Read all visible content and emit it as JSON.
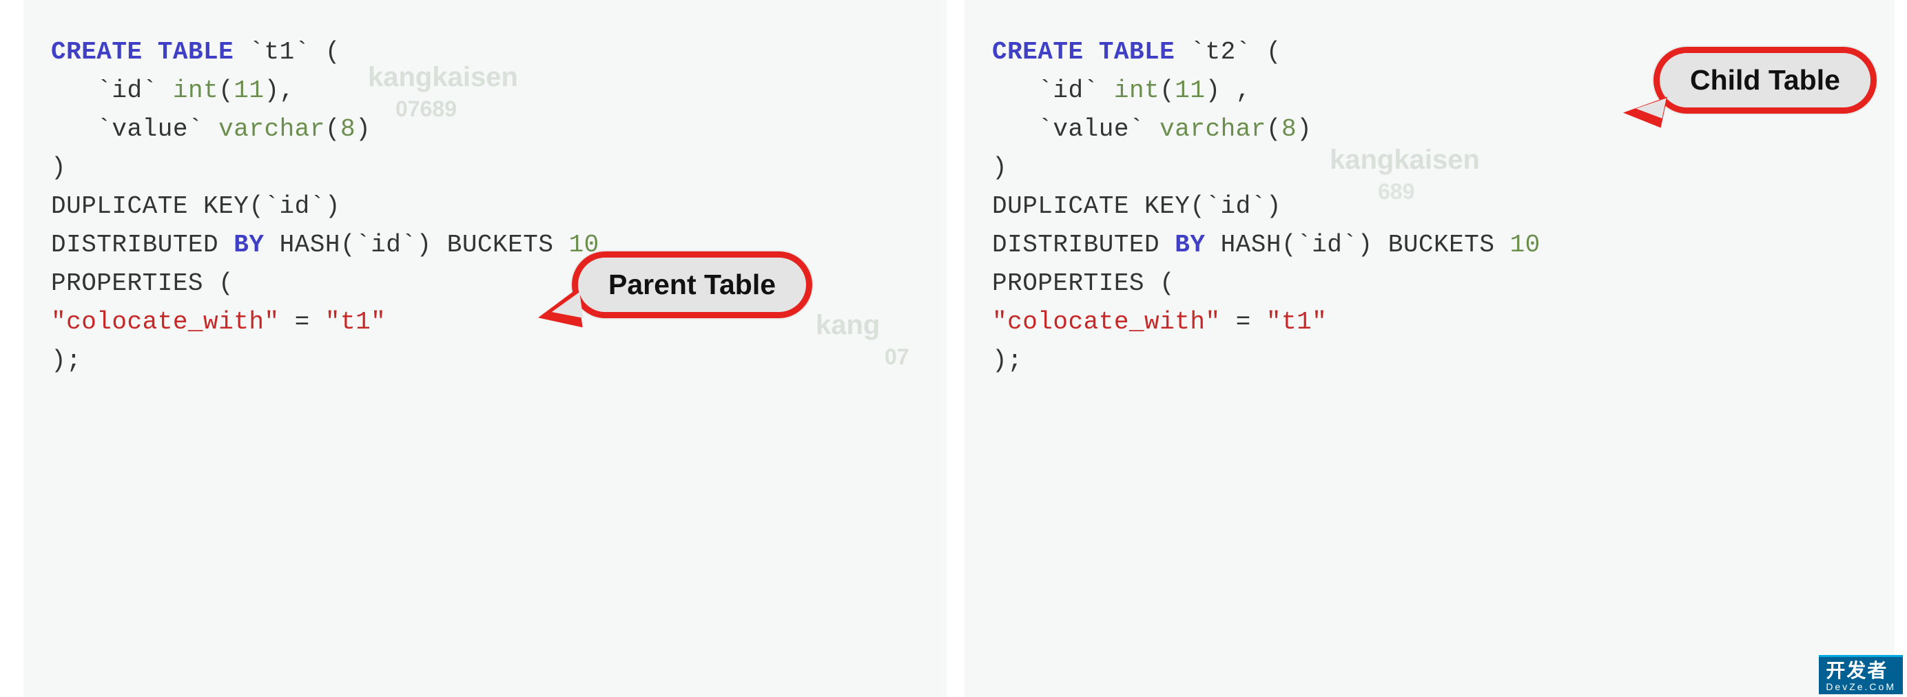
{
  "watermark": {
    "text": "kangkaisen",
    "sub": "07689"
  },
  "left": {
    "tokens": [
      {
        "t": "CREATE",
        "c": "kw"
      },
      {
        "t": " "
      },
      {
        "t": "TABLE",
        "c": "kw"
      },
      {
        "t": " "
      },
      {
        "t": "`t1`",
        "c": "bt"
      },
      {
        "t": " ("
      },
      {
        "t": "\n"
      },
      {
        "t": "   "
      },
      {
        "t": "`id`",
        "c": "bt"
      },
      {
        "t": " "
      },
      {
        "t": "int",
        "c": "ty"
      },
      {
        "t": "("
      },
      {
        "t": "11",
        "c": "num"
      },
      {
        "t": "),"
      },
      {
        "t": "\n"
      },
      {
        "t": "   "
      },
      {
        "t": "`value`",
        "c": "bt"
      },
      {
        "t": " "
      },
      {
        "t": "varchar",
        "c": "ty"
      },
      {
        "t": "("
      },
      {
        "t": "8",
        "c": "num"
      },
      {
        "t": ")"
      },
      {
        "t": "\n"
      },
      {
        "t": ")"
      },
      {
        "t": "\n"
      },
      {
        "t": "DUPLICATE KEY("
      },
      {
        "t": "`id`",
        "c": "bt"
      },
      {
        "t": ")"
      },
      {
        "t": "\n"
      },
      {
        "t": "DISTRIBUTED "
      },
      {
        "t": "BY",
        "c": "by"
      },
      {
        "t": " HASH("
      },
      {
        "t": "`id`",
        "c": "bt"
      },
      {
        "t": ") BUCKETS "
      },
      {
        "t": "10",
        "c": "num"
      },
      {
        "t": "\n"
      },
      {
        "t": "PROPERTIES ("
      },
      {
        "t": "\n"
      },
      {
        "t": "\"colocate_with\"",
        "c": "str"
      },
      {
        "t": " = "
      },
      {
        "t": "\"t1\"",
        "c": "str"
      },
      {
        "t": "\n"
      },
      {
        "t": ");"
      }
    ],
    "callout_label": "Parent Table"
  },
  "right": {
    "tokens": [
      {
        "t": "CREATE",
        "c": "kw"
      },
      {
        "t": " "
      },
      {
        "t": "TABLE",
        "c": "kw"
      },
      {
        "t": " "
      },
      {
        "t": "`t2`",
        "c": "bt"
      },
      {
        "t": " ("
      },
      {
        "t": "\n"
      },
      {
        "t": "   "
      },
      {
        "t": "`id`",
        "c": "bt"
      },
      {
        "t": " "
      },
      {
        "t": "int",
        "c": "ty"
      },
      {
        "t": "("
      },
      {
        "t": "11",
        "c": "num"
      },
      {
        "t": ") ,"
      },
      {
        "t": "\n"
      },
      {
        "t": "   "
      },
      {
        "t": "`value`",
        "c": "bt"
      },
      {
        "t": " "
      },
      {
        "t": "varchar",
        "c": "ty"
      },
      {
        "t": "("
      },
      {
        "t": "8",
        "c": "num"
      },
      {
        "t": ")"
      },
      {
        "t": "\n"
      },
      {
        "t": ")"
      },
      {
        "t": "\n"
      },
      {
        "t": "DUPLICATE KEY("
      },
      {
        "t": "`id`",
        "c": "bt"
      },
      {
        "t": ")"
      },
      {
        "t": "\n"
      },
      {
        "t": "DISTRIBUTED "
      },
      {
        "t": "BY",
        "c": "by"
      },
      {
        "t": " HASH("
      },
      {
        "t": "`id`",
        "c": "bt"
      },
      {
        "t": ") BUCKETS "
      },
      {
        "t": "10",
        "c": "num"
      },
      {
        "t": "\n"
      },
      {
        "t": "PROPERTIES ("
      },
      {
        "t": "\n"
      },
      {
        "t": "\"colocate_with\"",
        "c": "str"
      },
      {
        "t": " = "
      },
      {
        "t": "\"t1\"",
        "c": "str"
      },
      {
        "t": "\n"
      },
      {
        "t": ");"
      }
    ],
    "callout_label": "Child Table"
  },
  "logo": {
    "text": "开发者",
    "sub": "DevZe.CoM"
  }
}
